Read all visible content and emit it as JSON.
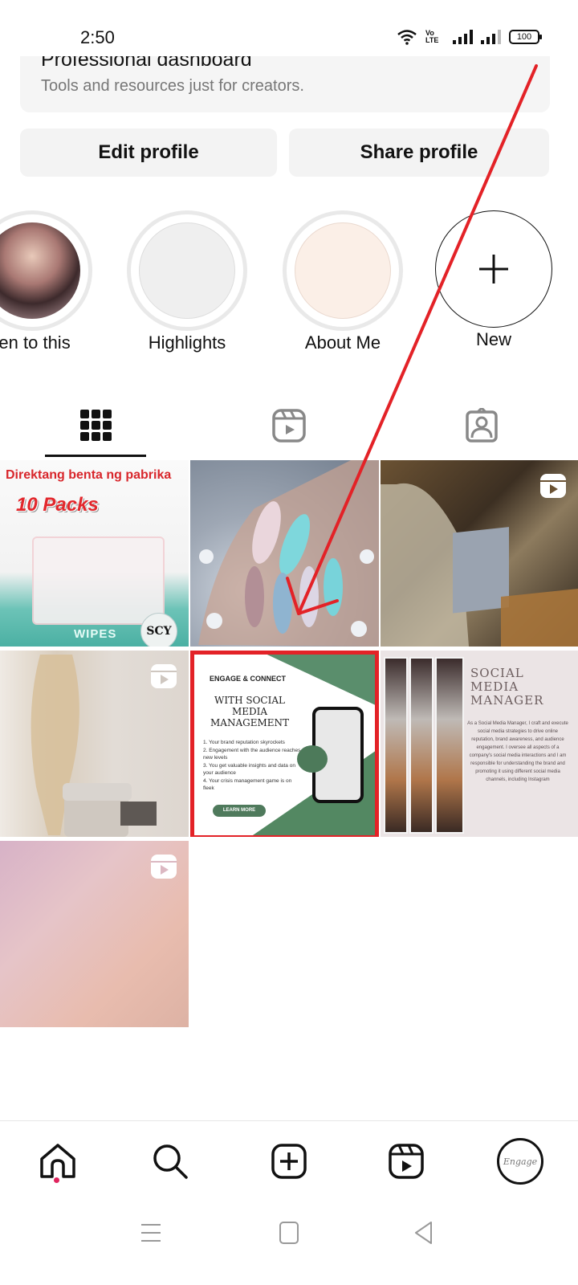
{
  "status_bar": {
    "time": "2:50",
    "volte_label": "Vo LTE",
    "battery": "100"
  },
  "pro_dashboard": {
    "title": "Professional dashboard",
    "subtitle": "Tools and resources just for creators."
  },
  "actions": {
    "edit_profile": "Edit profile",
    "share_profile": "Share profile"
  },
  "highlights": [
    {
      "label": "ten to this",
      "color": "#b98a86"
    },
    {
      "label": "Highlights",
      "color": "#efefef"
    },
    {
      "label": "About Me",
      "color": "#fbefe7"
    },
    {
      "label": "New",
      "icon": "plus-icon"
    }
  ],
  "tabs": [
    {
      "name": "posts-grid",
      "icon": "grid-icon",
      "active": true
    },
    {
      "name": "reels",
      "icon": "reels-icon",
      "active": false
    },
    {
      "name": "tagged",
      "icon": "tagged-person-icon",
      "active": false
    }
  ],
  "posts": [
    {
      "kind": "image",
      "headline": "Direktang benta ng pabrika",
      "sub_headline": "10 Packs",
      "product_text": "WIPES",
      "brand": "SCY"
    },
    {
      "kind": "image",
      "description": "Nail art photo"
    },
    {
      "kind": "reel",
      "description": "Person typing on laptop"
    },
    {
      "kind": "reel",
      "description": "Pampas grass and chair interior"
    },
    {
      "kind": "image",
      "selected": true,
      "header": "ENGAGE & CONNECT",
      "title": "WITH SOCIAL MEDIA MANAGEMENT",
      "list": [
        "1. Your brand reputation skyrockets",
        "2. Engagement with the audience reaches new levels",
        "3. You get valuable insights and data on your audience",
        "4. Your crisis management game is on fleek"
      ],
      "cta": "LEARN MORE"
    },
    {
      "kind": "image",
      "title": "SOCIAL MEDIA MANAGER",
      "body": "As a Social Media Manager, I craft and execute social media strategies to drive online reputation, brand awareness, and audience engagement. I oversee all aspects of a company's social media interactions and I am responsible for understanding the brand and promoting it using different social media channels, including Instagram"
    },
    {
      "kind": "reel",
      "description": "Pink watercolor abstract"
    }
  ],
  "bottom_nav": [
    {
      "name": "home",
      "icon": "home-icon",
      "notification": true
    },
    {
      "name": "search",
      "icon": "search-icon"
    },
    {
      "name": "create",
      "icon": "create-post-icon"
    },
    {
      "name": "reels",
      "icon": "reels-icon"
    },
    {
      "name": "profile",
      "icon": "profile-avatar",
      "avatar_text": "Engage"
    }
  ],
  "system_nav": [
    "menu",
    "home",
    "back"
  ],
  "annotation": {
    "color": "#e32227",
    "type": "arrow"
  }
}
